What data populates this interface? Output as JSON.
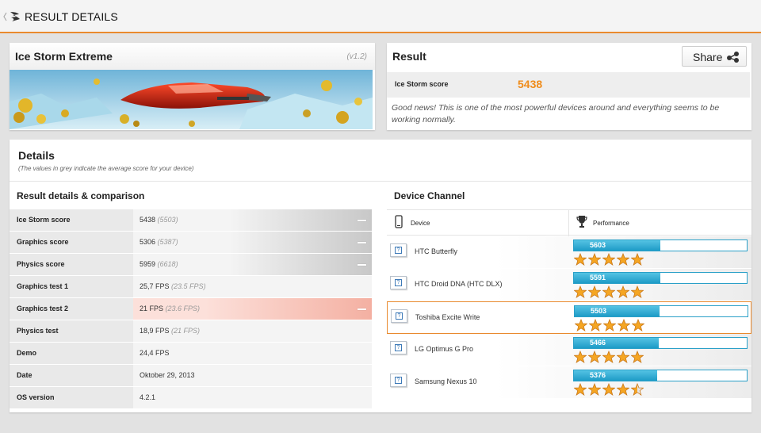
{
  "header": {
    "title": "RESULT DETAILS"
  },
  "benchmark": {
    "name": "Ice Storm Extreme",
    "version": "(v1.2)"
  },
  "result": {
    "title": "Result",
    "share_label": "Share",
    "score_label": "Ice Storm score",
    "score_value": "5438",
    "note": "Good news! This is one of the most powerful devices around and everything seems to be working normally."
  },
  "details": {
    "title": "Details",
    "subtitle": "(The values in grey indicate the average score for your device)",
    "comparison_title": "Result details & comparison",
    "rows": [
      {
        "label": "Ice Storm score",
        "value": "5438",
        "avg": "(5503)"
      },
      {
        "label": "Graphics score",
        "value": "5306",
        "avg": "(5387)"
      },
      {
        "label": "Physics score",
        "value": "5959",
        "avg": "(6618)"
      },
      {
        "label": "Graphics test 1",
        "value": "25,7 FPS",
        "avg": "(23.5 FPS)"
      },
      {
        "label": "Graphics test 2",
        "value": "21 FPS",
        "avg": "(23.6 FPS)"
      },
      {
        "label": "Physics test",
        "value": "18,9 FPS",
        "avg": "(21 FPS)"
      },
      {
        "label": "Demo",
        "value": "24,4 FPS",
        "avg": ""
      },
      {
        "label": "Date",
        "value": "Oktober 29, 2013",
        "avg": ""
      },
      {
        "label": "OS version",
        "value": "4.2.1",
        "avg": ""
      }
    ]
  },
  "device_channel": {
    "title": "Device Channel",
    "col_device": "Device",
    "col_performance": "Performance",
    "devices": [
      {
        "name": "HTC Butterfly",
        "score": "5603",
        "fill_fraction": 0.5,
        "stars": 5
      },
      {
        "name": "HTC Droid DNA (HTC DLX)",
        "score": "5591",
        "fill_fraction": 0.5,
        "stars": 5
      },
      {
        "name": "Toshiba Excite Write",
        "score": "5503",
        "fill_fraction": 0.49,
        "stars": 5
      },
      {
        "name": "LG Optimus G Pro",
        "score": "5466",
        "fill_fraction": 0.49,
        "stars": 5
      },
      {
        "name": "Samsung Nexus 10",
        "score": "5376",
        "fill_fraction": 0.48,
        "stars": 4.5
      }
    ]
  },
  "colors": {
    "accent": "#e98a2e",
    "score": "#f08c1a",
    "bar": "#2aa0c8"
  }
}
